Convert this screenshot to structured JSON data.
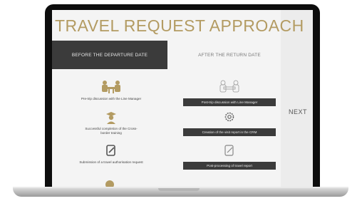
{
  "title": "TRAVEL REQUEST APPROACH",
  "headers": {
    "before": "BEFORE THE DEPARTURE DATE",
    "after": "AFTER THE RETURN DATE"
  },
  "before_steps": [
    {
      "icon": "meeting-icon",
      "label": "Pre-trip discussion with the Line Manager"
    },
    {
      "icon": "graduate-icon",
      "label": "Successful completion of the Cross-border training"
    },
    {
      "icon": "edit-document-icon",
      "label": "Submission of a travel authorisation request"
    }
  ],
  "after_steps": [
    {
      "icon": "meeting-outline-icon",
      "label": "Post-trip discussion with Line Manager"
    },
    {
      "icon": "gear-icon",
      "label": "Creation of the visit report in the CRM"
    },
    {
      "icon": "edit-document-outline-icon",
      "label": "Post-processing of travel report"
    }
  ],
  "next_label": "NEXT",
  "colors": {
    "gold": "#b39b62",
    "dark": "#3b3b3b",
    "gray": "#777777"
  }
}
